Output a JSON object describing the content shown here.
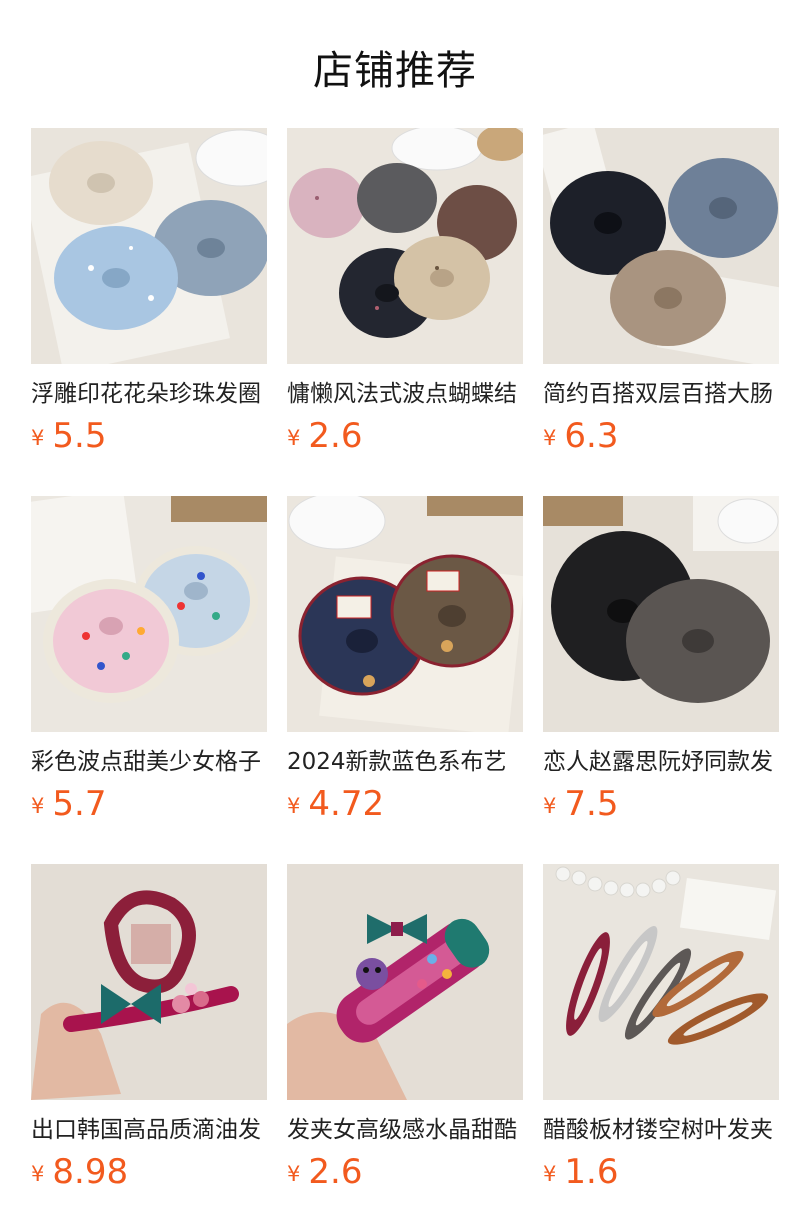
{
  "title": "店铺推荐",
  "currency": "¥",
  "products": [
    {
      "name": "浮雕印花花朵珍珠发圈",
      "price": "5.5",
      "image": "scrunchies-beige-blue-gray"
    },
    {
      "name": "慵懒风法式波点蝴蝶结",
      "price": "2.6",
      "image": "scrunchies-polka-dot-mix"
    },
    {
      "name": "简约百搭双层百搭大肠",
      "price": "6.3",
      "image": "scrunchies-black-blue-khaki"
    },
    {
      "name": "彩色波点甜美少女格子",
      "price": "5.7",
      "image": "scrunchies-lace-polka-dot"
    },
    {
      "name": "2024新款蓝色系布艺",
      "price": "4.72",
      "image": "scrunchies-navy-brown-label"
    },
    {
      "name": "恋人赵露思阮妤同款发",
      "price": "7.5",
      "image": "scrunchies-black-gray-large"
    },
    {
      "name": "出口韩国高品质滴油发",
      "price": "8.98",
      "image": "hair-claw-pink-green"
    },
    {
      "name": "发夹女高级感水晶甜酷",
      "price": "2.6",
      "image": "hair-clip-kitty-crystal"
    },
    {
      "name": "醋酸板材镂空树叶发夹",
      "price": "1.6",
      "image": "acetate-snap-clips"
    }
  ]
}
